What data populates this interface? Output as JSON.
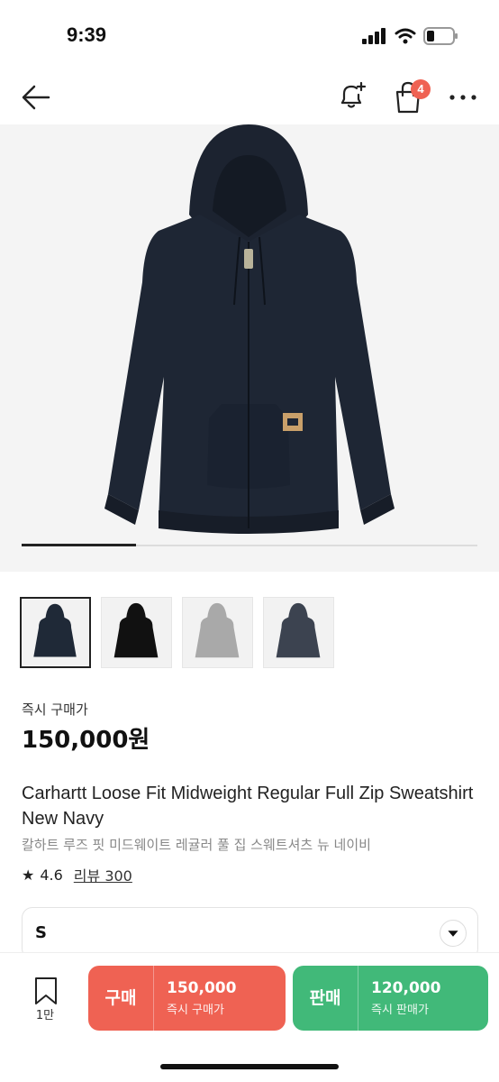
{
  "status": {
    "time": "9:39"
  },
  "nav": {
    "cart_badge": "4"
  },
  "product": {
    "price_label": "즉시 구매가",
    "price": "150,000원",
    "title_en": "Carhartt Loose Fit Midweight Regular Full Zip Sweatshirt New Navy",
    "title_ko": "칼하트 루즈 핏 미드웨이트 레귤러 풀 집 스웨트셔츠 뉴 네이비",
    "rating": "4.6",
    "review_label": "리뷰 300"
  },
  "thumbnails": [
    {
      "color": "#1f2937",
      "name": "navy"
    },
    {
      "color": "#111111",
      "name": "black"
    },
    {
      "color": "#a9a9a9",
      "name": "grey"
    },
    {
      "color": "#3c4350",
      "name": "dark-grey"
    }
  ],
  "size": {
    "selected": "S"
  },
  "bottom": {
    "bookmark_count": "1만",
    "buy": {
      "label": "구매",
      "price": "150,000",
      "sub": "즉시 구매가",
      "color": "#ef6253"
    },
    "sell": {
      "label": "판매",
      "price": "120,000",
      "sub": "즉시 판매가",
      "color": "#41b979"
    }
  },
  "carousel": {
    "progress": 0.25
  }
}
